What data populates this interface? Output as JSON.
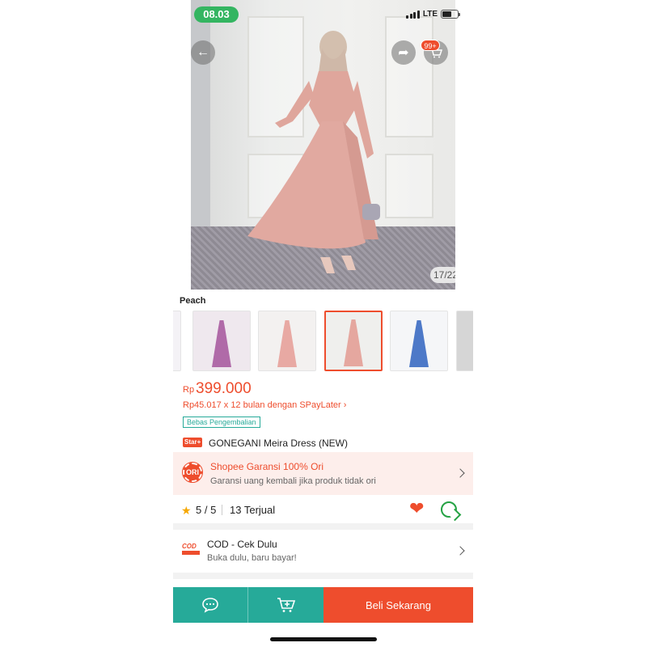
{
  "status_bar": {
    "time": "08.03",
    "network": "LTE"
  },
  "top_bar": {
    "cart_count": "99+"
  },
  "gallery": {
    "counter": "17/22",
    "variant_label": "Peach"
  },
  "thumbnails": [
    {
      "color": "#8f86b8",
      "bg": "#f4f2f6"
    },
    {
      "color": "#b06aa8",
      "bg": "#efe8ee"
    },
    {
      "color": "#e8a9a3",
      "bg": "#f3f1f0"
    },
    {
      "color": "#e5a79f",
      "bg": "#efefed"
    },
    {
      "color": "#4d79c8",
      "bg": "#f5f6f8"
    },
    {
      "color": "#7b7b80",
      "bg": "#d6d6d6"
    }
  ],
  "product": {
    "currency": "Rp",
    "price": "399.000",
    "paylater": "Rp45.017 x 12 bulan dengan SPayLater ›",
    "free_return": "Bebas Pengembalian",
    "star_badge": "Star+",
    "name": "GONEGANI Meira Dress (NEW)"
  },
  "guarantee": {
    "badge": "ORI",
    "title": "Shopee Garansi 100% Ori",
    "subtitle": "Garansi uang kembali jika produk tidak ori"
  },
  "stats": {
    "rating": "5 / 5",
    "sold": "13 Terjual"
  },
  "cod": {
    "icon_text": "COD",
    "title": "COD - Cek Dulu",
    "subtitle": "Buka dulu, baru bayar!"
  },
  "bottom_bar": {
    "buy_label": "Beli Sekarang"
  },
  "colors": {
    "accent": "#ee4d2d",
    "teal": "#26aa99",
    "status_green": "#34b561"
  }
}
